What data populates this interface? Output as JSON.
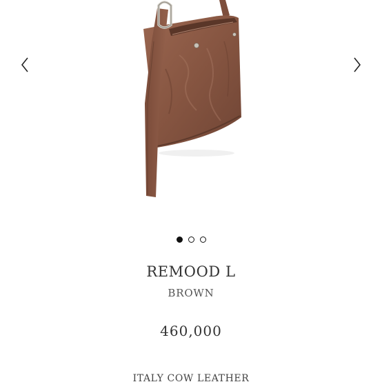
{
  "carousel": {
    "prev_icon": "chevron-left-icon",
    "next_icon": "chevron-right-icon",
    "slide_count": 3,
    "active_slide": 1,
    "image_subject": "brown leather tote bag with long strap"
  },
  "product": {
    "name": "REMOOD L",
    "color": "BROWN",
    "price": "460,000",
    "material": "ITALY COW LEATHER"
  },
  "colors": {
    "leather": "#8a5a45",
    "leather_dark": "#6b4232",
    "leather_light": "#a67560",
    "dot_active": "#111111"
  }
}
